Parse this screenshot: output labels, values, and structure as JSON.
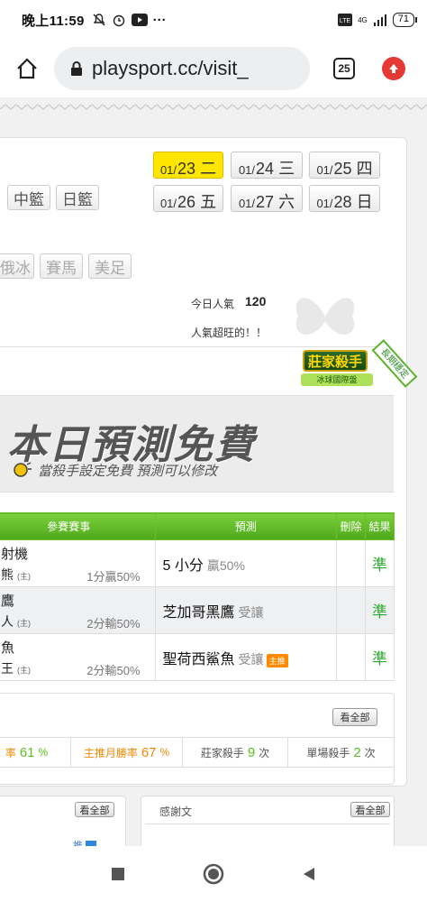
{
  "status": {
    "time": "晚上11:59",
    "more": "···",
    "net": "4G",
    "battery": "71"
  },
  "browser": {
    "url": "playsport.cc/visit_",
    "tab_count": "25"
  },
  "dates": [
    {
      "md": "01/",
      "d": "23",
      "wd": "二",
      "active": true
    },
    {
      "md": "01/",
      "d": "24",
      "wd": "三"
    },
    {
      "md": "01/",
      "d": "25",
      "wd": "四"
    },
    {
      "md": "01/",
      "d": "26",
      "wd": "五"
    },
    {
      "md": "01/",
      "d": "27",
      "wd": "六"
    },
    {
      "md": "01/",
      "d": "28",
      "wd": "日"
    }
  ],
  "sports": {
    "s1": "中籃",
    "s2": "日籃",
    "s3": "俄冰",
    "s4": "賽馬",
    "s5": "美足"
  },
  "popularity": {
    "label": "今日人氣",
    "value": "120",
    "note": "人氣超旺的！！"
  },
  "badge": {
    "title": "莊家殺手",
    "sub": "冰球國際盤",
    "ribbon": "長期穩定"
  },
  "banner": {
    "title": "本日預測免費",
    "subtitle": "當殺手設定免費  預測可以修改"
  },
  "table": {
    "headers": {
      "game": "參賽賽事",
      "pred": "預測",
      "del": "刪除",
      "result": "結果"
    },
    "rows": [
      {
        "t1": "射機",
        "t2": "熊",
        "tag": "(主)",
        "score": "1分贏50%",
        "pred": "5 小分",
        "sub": "贏50%",
        "badge": "",
        "result": "準"
      },
      {
        "t1": "鷹",
        "t2": "人",
        "tag": "(主)",
        "score": "2分輸50%",
        "pred": "芝加哥黑鷹",
        "sub": "受讓",
        "badge": "",
        "result": "準"
      },
      {
        "t1": "魚",
        "t2": "王",
        "tag": "(主)",
        "score": "2分輸50%",
        "pred": "聖荷西鯊魚",
        "sub": "受讓",
        "badge": "主推",
        "result": "準"
      }
    ]
  },
  "stats": {
    "view_all": "看全部",
    "s1_label": "率",
    "s1_value": "61",
    "s1_unit": "%",
    "s2_label": "主推月勝率",
    "s2_value": "67",
    "s2_unit": "%",
    "s3_label": "莊家殺手",
    "s3_value": "9",
    "s3_unit": "次",
    "s4_label": "單場殺手",
    "s4_value": "2",
    "s4_unit": "次"
  },
  "bottom": {
    "view_all_left": "看全部",
    "thanks_title": "感謝文",
    "view_all_right": "看全部",
    "push": "推"
  }
}
